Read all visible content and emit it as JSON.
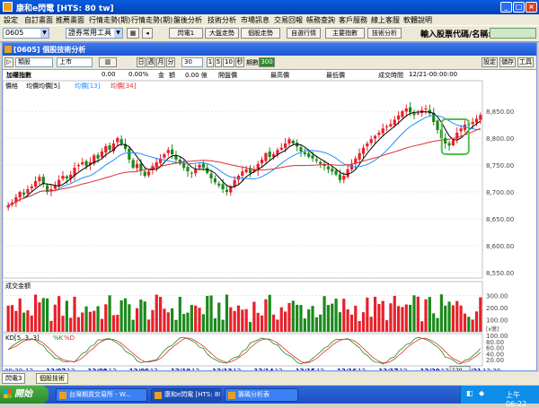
{
  "window": {
    "title": "康和e閃電 [HTS: 80 tw]",
    "controls": [
      "_",
      "□",
      "×"
    ]
  },
  "menu": [
    "設定",
    "自訂畫面",
    "推薦畫面",
    "行情走勢(期)",
    "行情走勢(期)",
    "盤後分析",
    "技術分析",
    "市場訊息",
    "交易回報",
    "帳務查詢",
    "客戶服務",
    "線上客服",
    "軟體說明"
  ],
  "toolbar": {
    "code": "0605",
    "tool_combo": "證券常用工具",
    "buttons": [
      "閃電1",
      "大盤走勢",
      "個股走勢",
      "自選行情",
      "主要指數",
      "技術分析"
    ],
    "search_label": "輸入股票代碼/名稱:",
    "search_value": ""
  },
  "subwindow": {
    "title": "[0605] 個股技術分析",
    "kind": "類股",
    "market": "上市",
    "interval_buttons": [
      "日",
      "週",
      "月",
      "分"
    ],
    "minutes": "30",
    "extra_buttons": [
      "1",
      "5",
      "10",
      "秒"
    ],
    "period_label": "期數",
    "period_value": "300",
    "right_buttons": [
      "設定",
      "儲存",
      "工具"
    ]
  },
  "info": {
    "stock": "加權指數",
    "price": "0.00",
    "change_pct": "0.00%",
    "amount_label": "金",
    "amount_unit": "額",
    "amount_value": "0.00 億",
    "open_label": "開盤價",
    "high_label": "最高價",
    "low_label": "最低價",
    "time_label": "成交時間",
    "time_value": "12/21-00:00:00"
  },
  "chart_data": {
    "type": "candlestick",
    "legend": {
      "price_label": "價格",
      "ma_label": "均價",
      "series": [
        {
          "name": "均價[5]",
          "color": "#000000"
        },
        {
          "name": "均價[13]",
          "color": "#1e90ff"
        },
        {
          "name": "均價[34]",
          "color": "#e03030"
        }
      ]
    },
    "price_ylim": [
      8540,
      8900
    ],
    "price_ticks": [
      8550,
      8600,
      8650,
      8700,
      8750,
      8800,
      8850
    ],
    "price_tick_labels": [
      "8,550.00",
      "8,600.00",
      "8,650.00",
      "8,700.00",
      "8,750.00",
      "8,800.00",
      "8,850.00"
    ],
    "closes": [
      8675,
      8680,
      8690,
      8700,
      8695,
      8705,
      8710,
      8720,
      8728,
      8715,
      8700,
      8705,
      8712,
      8722,
      8730,
      8725,
      8732,
      8745,
      8750,
      8755,
      8748,
      8755,
      8768,
      8762,
      8775,
      8785,
      8778,
      8790,
      8800,
      8790,
      8780,
      8760,
      8745,
      8752,
      8740,
      8730,
      8738,
      8748,
      8755,
      8762,
      8770,
      8778,
      8770,
      8760,
      8752,
      8745,
      8738,
      8735,
      8742,
      8750,
      8745,
      8735,
      8725,
      8718,
      8712,
      8705,
      8700,
      8710,
      8722,
      8730,
      8738,
      8742,
      8735,
      8742,
      8752,
      8760,
      8772,
      8765,
      8770,
      8778,
      8782,
      8790,
      8798,
      8790,
      8784,
      8775,
      8770,
      8765,
      8762,
      8758,
      8752,
      8748,
      8742,
      8738,
      8732,
      8722,
      8730,
      8742,
      8752,
      8762,
      8772,
      8782,
      8790,
      8798,
      8804,
      8810,
      8818,
      8822,
      8826,
      8834,
      8842,
      8850,
      8855,
      8848,
      8843,
      8846,
      8852,
      8855,
      8846,
      8830,
      8815,
      8800,
      8790,
      8786,
      8796,
      8810,
      8818,
      8825,
      8824,
      8830,
      8836,
      8843
    ],
    "volume_label": "成交金額",
    "volume_unit": "[x億]",
    "volume_ylim": [
      0,
      400
    ],
    "volume_ticks": [
      100,
      200,
      300
    ],
    "volume_tick_labels": [
      "100.00",
      "200.00",
      "300.00"
    ],
    "kd_label": "KD[5, 3, 3]",
    "kd_k_label": "%K",
    "kd_d_label": "%D",
    "kd_ylim": [
      0,
      100
    ],
    "kd_ticks": [
      20,
      40,
      60,
      80,
      100
    ],
    "kd_tick_labels": [
      "20.00",
      "40.00",
      "60.00",
      "80.00",
      "100.00"
    ],
    "x_labels": [
      "09:30",
      "12",
      "12/07",
      "12",
      "12/08",
      "12",
      "12/09",
      "12",
      "12/10",
      "12",
      "12/13",
      "12",
      "12/14",
      "12",
      "12/15",
      "12",
      "12/16",
      "12",
      "12/17",
      "12",
      "12/20",
      "12",
      "12/21",
      "13:30"
    ],
    "zoom": "120",
    "colors": {
      "up": "#e8202a",
      "down": "#1a8a1a",
      "highlight": "#4ec04e"
    }
  },
  "tabs": [
    "閃電3",
    "個股技術"
  ],
  "taskbar": {
    "start": "開始",
    "tasks": [
      "台灣期貨交易所 - W...",
      "康和e閃電 [HTS: 80 ...",
      "籌碼分析表"
    ],
    "clock": "上午 06:22"
  }
}
